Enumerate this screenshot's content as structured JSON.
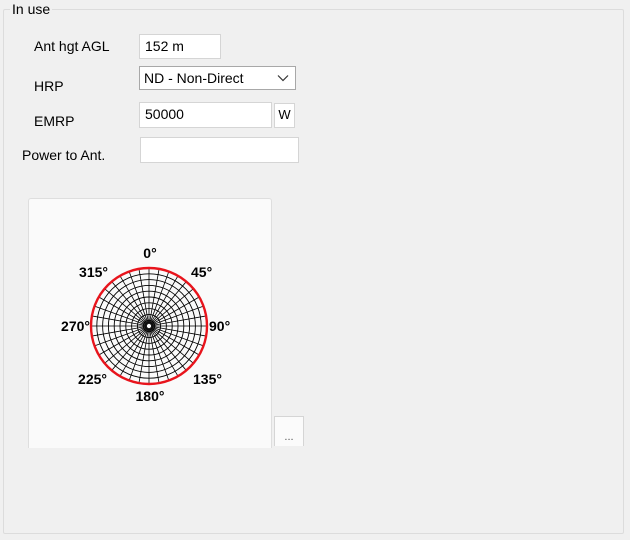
{
  "group": {
    "title": "In use"
  },
  "antenna": {
    "height_label": "Ant hgt AGL",
    "height_value": "152 m",
    "hrp_label": "HRP",
    "hrp_value": "ND - Non-Direct",
    "emrp_label": "EMRP",
    "emrp_value": "50000",
    "emrp_unit": "W",
    "power_label": "Power to Ant.",
    "power_value": ""
  },
  "pattern": {
    "directions": {
      "n": "0°",
      "ne": "45°",
      "e": "90°",
      "se": "135°",
      "s": "180°",
      "sw": "225°",
      "w": "270°",
      "nw": "315°"
    },
    "pattern_color": "#e8141c",
    "grid_color": "#000000"
  },
  "more_button": {
    "label": "..."
  }
}
